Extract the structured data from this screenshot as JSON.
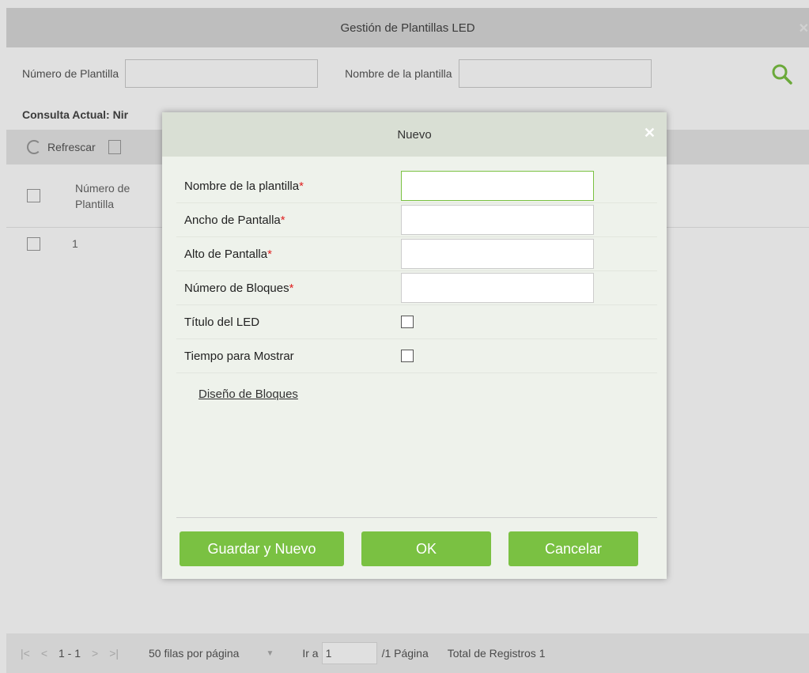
{
  "background": {
    "title": "Gestión de Plantillas LED",
    "search": {
      "label1": "Número de Plantilla",
      "label2": "Nombre de la plantilla"
    },
    "query_label": "Consulta Actual:",
    "query_value": "Nir",
    "toolbar": {
      "refresh": "Refrescar"
    },
    "table": {
      "col1": "Número de Plantilla",
      "rows": [
        {
          "num": "1"
        }
      ]
    },
    "pager": {
      "range": "1 - 1",
      "per_page": "50 filas por página",
      "goto_label": "Ir a",
      "goto_value": "1",
      "pages": "/1 Página",
      "total": "Total de Registros 1"
    }
  },
  "modal": {
    "title": "Nuevo",
    "fields": [
      {
        "label": "Nombre de la plantilla",
        "required": true,
        "type": "text",
        "value": ""
      },
      {
        "label": "Ancho de Pantalla",
        "required": true,
        "type": "text",
        "value": ""
      },
      {
        "label": "Alto de Pantalla",
        "required": true,
        "type": "text",
        "value": ""
      },
      {
        "label": "Número de Bloques",
        "required": true,
        "type": "text",
        "value": ""
      },
      {
        "label": "Título del LED",
        "required": false,
        "type": "checkbox",
        "checked": false
      },
      {
        "label": "Tiempo para Mostrar",
        "required": false,
        "type": "checkbox",
        "checked": false
      }
    ],
    "required_mark": "*",
    "link": "Diseño de Bloques",
    "buttons": {
      "save_new": "Guardar y Nuevo",
      "ok": "OK",
      "cancel": "Cancelar"
    }
  },
  "colors": {
    "accent": "#7ac142",
    "title_bar": "#d9d9d9",
    "modal_bg": "#eef2eb",
    "required": "#e02020"
  }
}
